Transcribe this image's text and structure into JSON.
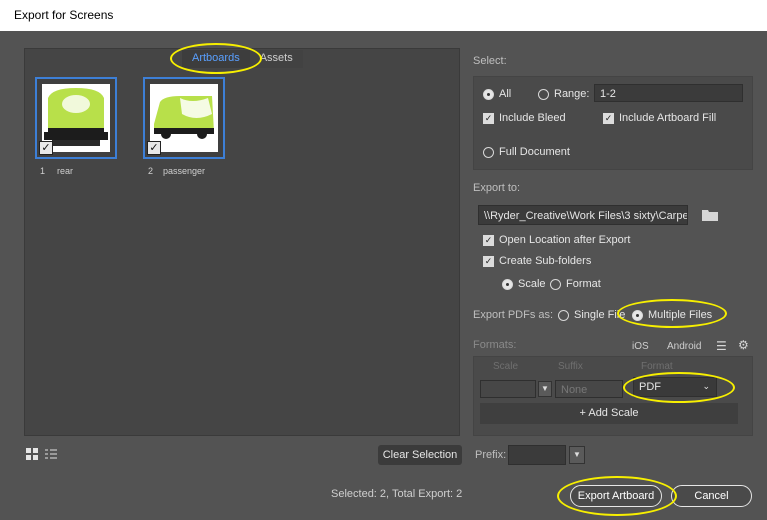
{
  "window": {
    "title": "Export for Screens"
  },
  "tabs": [
    {
      "label": "Artboards"
    },
    {
      "label": "Assets"
    }
  ],
  "artboards": [
    {
      "number": "1",
      "name": "rear"
    },
    {
      "number": "2",
      "name": "passenger"
    }
  ],
  "select": {
    "label": "Select:",
    "all_label": "All",
    "range_label": "Range:",
    "range_value": "1-2",
    "include_bleed": "Include Bleed",
    "include_artboard_fill": "Include Artboard Fill",
    "full_document": "Full Document"
  },
  "export_to": {
    "label": "Export to:",
    "path": "\\\\Ryder_Creative\\Work Files\\3 sixty\\Carpe",
    "open_location": "Open Location after Export",
    "create_subfolders": "Create Sub-folders",
    "scale_label": "Scale",
    "format_label": "Format"
  },
  "export_pdfs": {
    "label": "Export PDFs as:",
    "single_file": "Single File",
    "multiple_files": "Multiple Files"
  },
  "formats": {
    "label": "Formats:",
    "ios": "iOS",
    "android": "Android",
    "col_scale": "Scale",
    "col_suffix": "Suffix",
    "col_format": "Format",
    "suffix_placeholder": "None",
    "format_value": "PDF",
    "add_scale": "+ Add Scale"
  },
  "bottom": {
    "clear_selection": "Clear Selection",
    "prefix_label": "Prefix:",
    "status": "Selected: 2, Total Export: 2",
    "export_button": "Export Artboard",
    "cancel_button": "Cancel"
  },
  "colors": {
    "accent": "#3d7fd6",
    "highlight": "#f7ef00",
    "van_green": "#b8e04a"
  }
}
